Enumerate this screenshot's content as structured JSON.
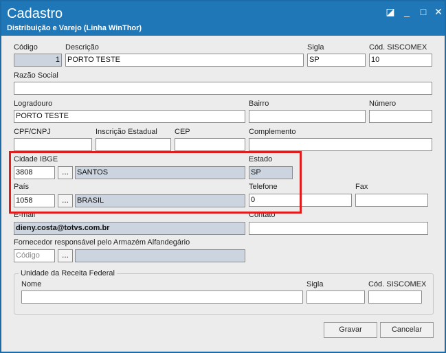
{
  "window": {
    "title": "Cadastro",
    "subtitle": "Distribuição e Varejo (Linha WinThor)",
    "controls": {
      "restore": "◪",
      "minimize": "_",
      "maximize": "□",
      "close": "✕"
    }
  },
  "labels": {
    "codigo": "Código",
    "descricao": "Descrição",
    "sigla": "Sigla",
    "cod_siscomex": "Cód. SISCOMEX",
    "razao_social": "Razão Social",
    "logradouro": "Logradouro",
    "bairro": "Bairro",
    "numero": "Número",
    "cpf_cnpj": "CPF/CNPJ",
    "inscricao_estadual": "Inscrição Estadual",
    "cep": "CEP",
    "complemento": "Complemento",
    "cidade_ibge": "Cidade IBGE",
    "estado": "Estado",
    "pais": "País",
    "telefone": "Telefone",
    "fax": "Fax",
    "email": "E-mail",
    "contato": "Contato",
    "fornecedor": "Fornecedor responsável pelo Armazém Alfandegário"
  },
  "values": {
    "codigo": "1",
    "descricao": "PORTO TESTE",
    "sigla": "SP",
    "cod_siscomex": "10",
    "razao_social": "",
    "logradouro": "PORTO TESTE",
    "bairro": "",
    "numero": "",
    "cpf_cnpj": "",
    "inscricao_estadual": "",
    "cep": "",
    "complemento": "",
    "cidade_codigo": "3808",
    "cidade_nome": "SANTOS",
    "estado": "SP",
    "pais_codigo": "1058",
    "pais_nome": "BRASIL",
    "telefone": "0",
    "fax": "",
    "email": "dieny.costa@totvs.com.br",
    "contato": "",
    "fornecedor_nome": ""
  },
  "placeholders": {
    "fornecedor_codigo": "Código"
  },
  "lookup_button": "...",
  "receita_federal": {
    "title": "Unidade da Receita Federal",
    "labels": {
      "nome": "Nome",
      "sigla": "Sigla",
      "cod_siscomex": "Cód. SISCOMEX"
    },
    "values": {
      "nome": "",
      "sigla": "",
      "cod_siscomex": ""
    }
  },
  "buttons": {
    "gravar": "Gravar",
    "cancelar": "Cancelar"
  },
  "colors": {
    "titlebar": "#1f77b8",
    "highlight": "#e01d1d",
    "readonly_field": "#ccd5df"
  }
}
